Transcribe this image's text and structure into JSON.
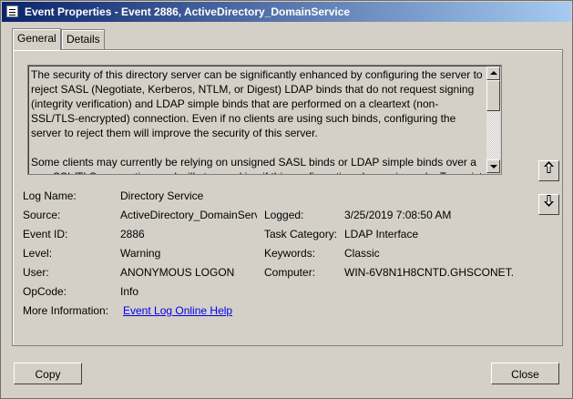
{
  "window": {
    "title": "Event Properties - Event 2886, ActiveDirectory_DomainService"
  },
  "tabs": [
    {
      "label": "General"
    },
    {
      "label": "Details"
    }
  ],
  "description": {
    "paragraphs": [
      "The security of this directory server can be significantly enhanced by configuring the server to reject SASL (Negotiate,  Kerberos, NTLM, or Digest) LDAP binds that do not request signing (integrity verification) and LDAP simple binds that  are performed on a cleartext (non-SSL/TLS-encrypted) connection.  Even if no clients are using such binds, configuring the server to reject them will improve the security of this server.",
      "Some clients may currently be relying on unsigned SASL binds or LDAP simple binds over a non-SSL/TLS connection, and will stop working if this configuration change is made.  To assist"
    ]
  },
  "fields": {
    "log_name": {
      "label": "Log Name:",
      "value": "Directory Service"
    },
    "source": {
      "label": "Source:",
      "value": "ActiveDirectory_DomainServ"
    },
    "logged": {
      "label": "Logged:",
      "value": "3/25/2019 7:08:50 AM"
    },
    "event_id": {
      "label": "Event ID:",
      "value": "2886"
    },
    "task_category": {
      "label": "Task Category:",
      "value": "LDAP Interface"
    },
    "level": {
      "label": "Level:",
      "value": "Warning"
    },
    "keywords": {
      "label": "Keywords:",
      "value": "Classic"
    },
    "user": {
      "label": "User:",
      "value": "ANONYMOUS LOGON"
    },
    "computer": {
      "label": "Computer:",
      "value": "WIN-6V8N1H8CNTD.GHSCONET."
    },
    "opcode": {
      "label": "OpCode:",
      "value": "Info"
    },
    "more_info": {
      "label": "More Information:",
      "value": "Event Log Online Help"
    }
  },
  "buttons": {
    "copy": "Copy",
    "close": "Close"
  },
  "icons": {
    "title": "event-viewer-icon",
    "previous": "arrow-up-icon",
    "next": "arrow-down-icon"
  },
  "colors": {
    "title_bar_start": "#0a246a",
    "title_bar_end": "#a6caf0",
    "link": "#0000ee",
    "face": "#d4d0c8"
  }
}
